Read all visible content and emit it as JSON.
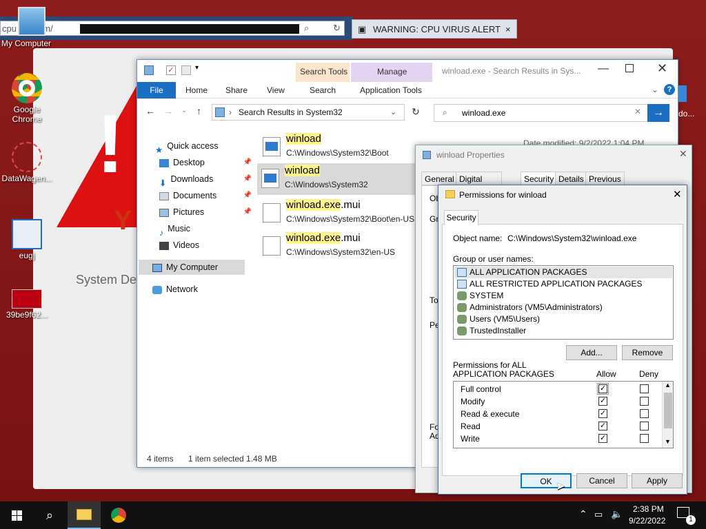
{
  "browser": {
    "url": "cpu    ing.com/",
    "tab": "WARNING: CPU VIRUS ALERT"
  },
  "bg_page": {
    "partial_text_1": "Y",
    "partial_text_2": "System De"
  },
  "desktop_icons": [
    {
      "label": "My Computer",
      "icon": "computer-icon"
    },
    {
      "label": "Google Chrome",
      "icon": "chrome-icon"
    },
    {
      "label": "DataWagen...",
      "icon": "datawagen-icon"
    },
    {
      "label": "eugj",
      "icon": "window-icon"
    },
    {
      "label": "39be9f62...",
      "icon": "image-icon"
    }
  ],
  "explorer": {
    "title": "winload.exe - Search Results in Sys...",
    "context_tabs": {
      "search_tools": "Search Tools",
      "manage": "Manage"
    },
    "ribbon": {
      "file": "File",
      "home": "Home",
      "share": "Share",
      "view": "View",
      "search": "Search",
      "app_tools": "Application Tools"
    },
    "address": "Search Results in System32",
    "search_query": "winload.exe",
    "nav": [
      {
        "label": "Quick access",
        "pinned": false
      },
      {
        "label": "Desktop",
        "pinned": true
      },
      {
        "label": "Downloads",
        "pinned": true
      },
      {
        "label": "Documents",
        "pinned": true
      },
      {
        "label": "Pictures",
        "pinned": true
      },
      {
        "label": "Music",
        "pinned": false
      },
      {
        "label": "Videos",
        "pinned": false
      },
      {
        "label": "My Computer",
        "pinned": false
      },
      {
        "label": "Network",
        "pinned": false
      }
    ],
    "results": [
      {
        "name_hl": "winload",
        "name_rest": "",
        "path": "C:\\Windows\\System32\\Boot"
      },
      {
        "name_hl": "winload",
        "name_rest": "",
        "path": "C:\\Windows\\System32"
      },
      {
        "name_hl": "winload.exe",
        "name_rest": ".mui",
        "path": "C:\\Windows\\System32\\Boot\\en-US"
      },
      {
        "name_hl": "winload.exe",
        "name_rest": ".mui",
        "path": "C:\\Windows\\System32\\en-US"
      }
    ],
    "date_modified": "Date modified: 9/2/2022 1:04 PM",
    "status": {
      "items": "4 items",
      "selected": "1 item selected  1.48 MB"
    }
  },
  "properties": {
    "title": "winload Properties",
    "tabs": [
      "General",
      "Digital Signatures",
      "Security",
      "Details",
      "Previous Versions"
    ],
    "active_tab": "Security",
    "side_frag": [
      "Ob",
      "Gro",
      "To",
      "Pe",
      "Fo",
      "Ad"
    ]
  },
  "permissions": {
    "title": "Permissions for winload",
    "tab": "Security",
    "object_label": "Object name:",
    "object_value": "C:\\Windows\\System32\\winload.exe",
    "group_label": "Group or user names:",
    "users": [
      "ALL APPLICATION PACKAGES",
      "ALL RESTRICTED APPLICATION PACKAGES",
      "SYSTEM",
      "Administrators (VM5\\Administrators)",
      "Users (VM5\\Users)",
      "TrustedInstaller"
    ],
    "add": "Add...",
    "remove": "Remove",
    "perm_label_1": "Permissions for ALL",
    "perm_label_2": "APPLICATION PACKAGES",
    "allow": "Allow",
    "deny": "Deny",
    "perms": [
      {
        "name": "Full control",
        "allow": "✓",
        "deny": ""
      },
      {
        "name": "Modify",
        "allow": "✓",
        "deny": ""
      },
      {
        "name": "Read & execute",
        "allow": "✓",
        "deny": ""
      },
      {
        "name": "Read",
        "allow": "✓",
        "deny": ""
      },
      {
        "name": "Write",
        "allow": "✓",
        "deny": ""
      }
    ],
    "ok": "OK",
    "cancel": "Cancel",
    "apply": "Apply"
  },
  "taskbar": {
    "time": "2:38 PM",
    "date": "9/22/2022",
    "notif_count": "1"
  }
}
